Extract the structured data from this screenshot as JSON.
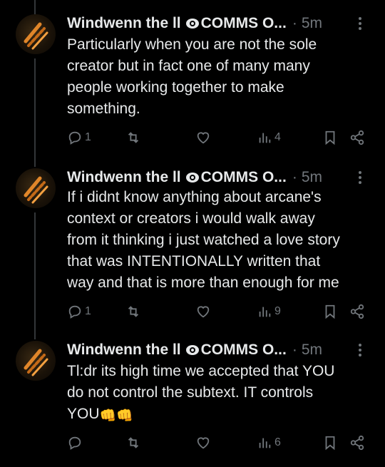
{
  "tweets": [
    {
      "author": "Windwenn the ll",
      "badge_text": "COMMS O...",
      "separator": "·",
      "time": "5m",
      "lines": [
        "Particularly when you are not the sole",
        "creator but in fact one of many many",
        "people working together to make",
        "something."
      ],
      "replies": "1",
      "retweets": "",
      "likes": "",
      "views": "4"
    },
    {
      "author": "Windwenn the ll",
      "badge_text": "COMMS O...",
      "separator": "·",
      "time": "5m",
      "lines": [
        "If i didnt know anything about arcane's",
        "context or creators i would walk away",
        "from it thinking i just watched a love story",
        "that was INTENTIONALLY written that",
        "way and that is more than enough for me"
      ],
      "replies": "1",
      "retweets": "",
      "likes": "",
      "views": "9"
    },
    {
      "author": "Windwenn the ll",
      "badge_text": "COMMS O...",
      "separator": "·",
      "time": "5m",
      "lines": [
        "Tl:dr its high time we accepted that YOU",
        "do not control the subtext. IT controls",
        "YOU"
      ],
      "emoji": "👊👊",
      "replies": "",
      "retweets": "",
      "likes": "",
      "views": "6"
    }
  ],
  "icons": {
    "reply": "reply-icon",
    "retweet": "retweet-icon",
    "like": "heart-icon",
    "views": "views-icon",
    "bookmark": "bookmark-icon",
    "share": "share-icon",
    "more": "more-icon",
    "badge": "eye-icon"
  },
  "colors": {
    "background": "#000000",
    "text": "#e7e9ea",
    "muted": "#71767b",
    "thread_line": "#333639"
  }
}
